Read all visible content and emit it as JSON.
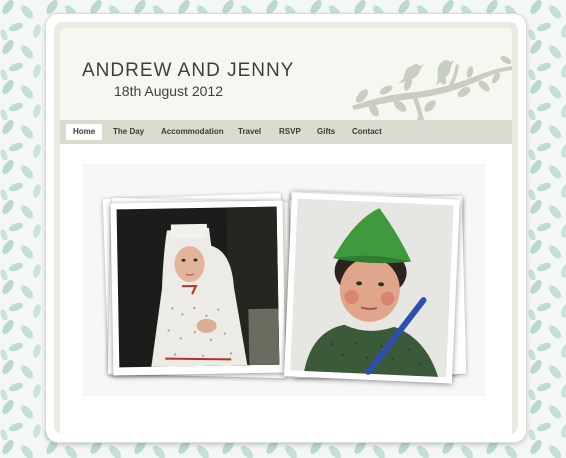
{
  "site": {
    "title": "ANDREW AND JENNY",
    "date": "18th August 2012"
  },
  "nav": {
    "items": [
      {
        "label": "Home",
        "active": true
      },
      {
        "label": "The Day"
      },
      {
        "label": "Accommodation"
      },
      {
        "label": "Travel"
      },
      {
        "label": "RSVP"
      },
      {
        "label": "Gifts"
      },
      {
        "label": "Contact"
      }
    ]
  },
  "photos": [
    {
      "name": "girl-nativity-costume-photo",
      "subject": "child in white headdress and dotted dress"
    },
    {
      "name": "boy-robin-hood-photo",
      "subject": "child in green pointed hat"
    }
  ],
  "colors": {
    "page_background": "#f4f8f5",
    "leaf_pattern": "#a9cfc0",
    "header_background": "#f6f7f1",
    "nav_background": "#d9ddd0",
    "branch_silhouette": "#c9cec2",
    "text": "#3f3f3f"
  }
}
